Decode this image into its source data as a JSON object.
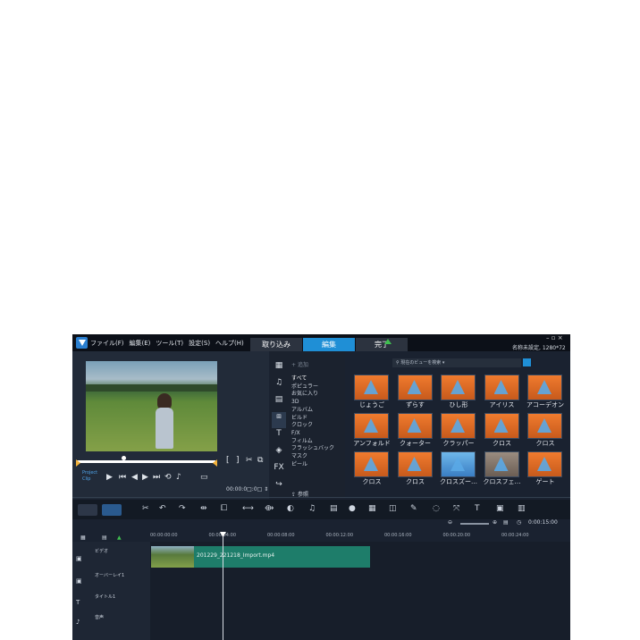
{
  "menu": [
    "ファイル(F)",
    "編集(E)",
    "ツール(T)",
    "設定(S)",
    "ヘルプ(H)"
  ],
  "workspace_tabs": {
    "capture": "取り込み",
    "edit": "編集",
    "share": "完了"
  },
  "project_info": "名称未設定, 1280*72",
  "window_controls": "– ▫ ×",
  "player": {
    "mode_project": "Project",
    "mode_clip": "Clip",
    "timecode": "00:00:0□:0□ ⇕"
  },
  "categories": {
    "add_label": "追加",
    "items": [
      "すべて",
      "ポピュラー",
      "お気に入り",
      "3D",
      "アルバム",
      "ビルド",
      "クロック",
      "F/X",
      "フィルム",
      "フラッシュバック",
      "マスク",
      "ピール"
    ],
    "active_index": 0,
    "browse_label": "参照"
  },
  "library": {
    "search_placeholder": "現在のビューを検索"
  },
  "transitions": [
    {
      "label": "じょうご",
      "style": "o"
    },
    {
      "label": "ずらす",
      "style": "o"
    },
    {
      "label": "ひし形",
      "style": "o"
    },
    {
      "label": "アイリス",
      "style": "o"
    },
    {
      "label": "アコーデオン",
      "style": "o"
    },
    {
      "label": "アンフォルド",
      "style": "o"
    },
    {
      "label": "クォーター",
      "style": "o"
    },
    {
      "label": "クラッパー",
      "style": "o"
    },
    {
      "label": "クロス",
      "style": "o"
    },
    {
      "label": "クロス",
      "style": "o"
    },
    {
      "label": "クロス",
      "style": "o"
    },
    {
      "label": "クロス",
      "style": "o"
    },
    {
      "label": "クロスズー…",
      "style": "b"
    },
    {
      "label": "クロスフェ…",
      "style": "g"
    },
    {
      "label": "ゲート",
      "style": "o"
    }
  ],
  "zoom": {
    "timecode": "0:00:15:00"
  },
  "timeline": {
    "ruler": [
      "00:00:00:00",
      "00:00:04:00",
      "00:00:08:00",
      "00:00:12:00",
      "00:00:16:00",
      "00:00:20:00",
      "00:00:24:00"
    ],
    "tracks": [
      {
        "name": "ビデオ"
      },
      {
        "name": "オーバーレイ1"
      },
      {
        "name": "タイトル1"
      },
      {
        "name": "音声"
      }
    ],
    "clip_name": "201229_221218_Import.mp4"
  },
  "accent_color": "#1f8fd6",
  "clip_color": "#1e7d6a"
}
